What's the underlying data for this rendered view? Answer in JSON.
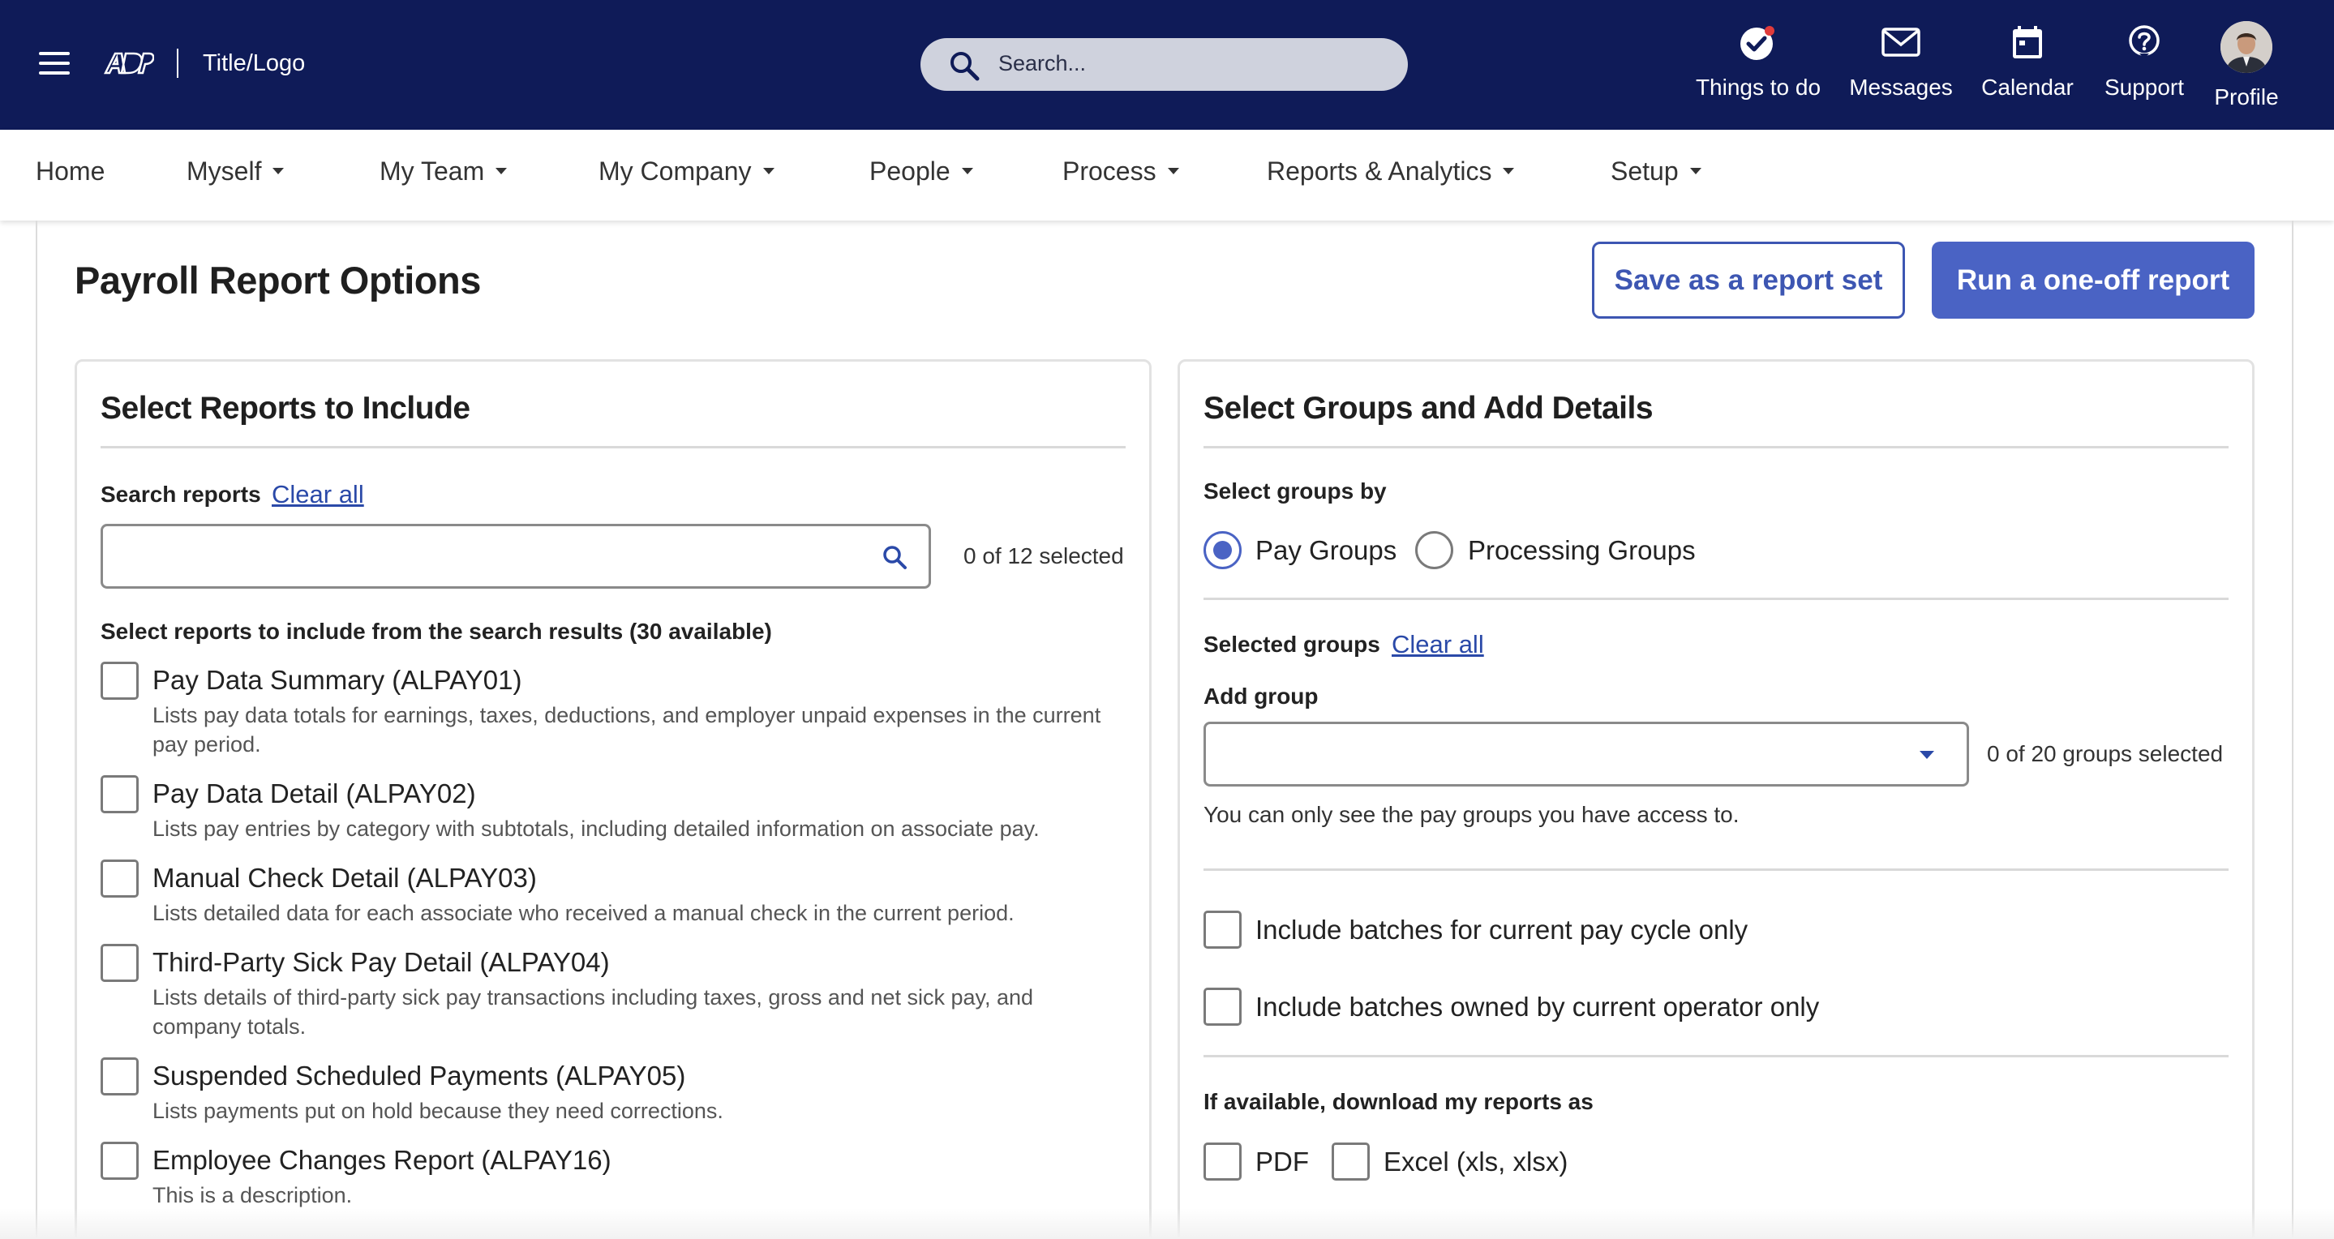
{
  "header": {
    "title_logo": "Title/Logo",
    "search_placeholder": "Search...",
    "actions": [
      {
        "label": "Things to do",
        "icon": "check-circle-icon"
      },
      {
        "label": "Messages",
        "icon": "mail-icon"
      },
      {
        "label": "Calendar",
        "icon": "calendar-icon"
      },
      {
        "label": "Support",
        "icon": "help-icon"
      },
      {
        "label": "Profile",
        "icon": "avatar"
      }
    ]
  },
  "nav": {
    "items": [
      "Home",
      "Myself",
      "My Team",
      "My Company",
      "People",
      "Process",
      "Reports & Analytics",
      "Setup"
    ]
  },
  "page": {
    "title": "Payroll Report Options",
    "save_button": "Save as a report set",
    "run_button": "Run a one-off report"
  },
  "left_panel": {
    "heading": "Select Reports to Include",
    "search_label": "Search reports",
    "clear_all": "Clear all",
    "search_value": "",
    "selected_count": "0 of 12 selected",
    "results_label": "Select reports to include from the search results (30 available)",
    "reports": [
      {
        "title": "Pay Data Summary (ALPAY01)",
        "desc": "Lists pay data totals for earnings, taxes, deductions, and employer unpaid expenses in the current pay period.",
        "checked": false
      },
      {
        "title": "Pay Data Detail (ALPAY02)",
        "desc": "Lists pay entries by category with subtotals, including detailed information on associate pay.",
        "checked": false
      },
      {
        "title": "Manual Check Detail (ALPAY03)",
        "desc": "Lists detailed data for each associate who received a manual check in the current period.",
        "checked": false
      },
      {
        "title": "Third-Party Sick Pay Detail (ALPAY04)",
        "desc": "Lists details of third-party sick pay transactions including taxes, gross and net sick pay, and company totals.",
        "checked": false
      },
      {
        "title": "Suspended Scheduled Payments (ALPAY05)",
        "desc": "Lists payments put on hold because they need corrections.",
        "checked": false
      },
      {
        "title": "Employee Changes Report (ALPAY16)",
        "desc": "This is a description.",
        "checked": false
      }
    ]
  },
  "right_panel": {
    "heading": "Select Groups and Add Details",
    "select_by_label": "Select groups by",
    "radio_options": [
      {
        "label": "Pay Groups",
        "selected": true
      },
      {
        "label": "Processing Groups",
        "selected": false
      }
    ],
    "selected_groups_label": "Selected groups",
    "clear_all": "Clear all",
    "add_group_label": "Add group",
    "add_group_value": "",
    "groups_count": "0 of 20 groups selected",
    "access_note": "You can only see the pay groups you have access to.",
    "batch_options": [
      {
        "label": "Include batches for current pay cycle only",
        "checked": false
      },
      {
        "label": "Include batches owned by current operator only",
        "checked": false
      }
    ],
    "download_label": "If available, download my reports as",
    "download_options": [
      {
        "label": "PDF",
        "checked": false
      },
      {
        "label": "Excel (xls, xlsx)",
        "checked": false
      }
    ]
  }
}
